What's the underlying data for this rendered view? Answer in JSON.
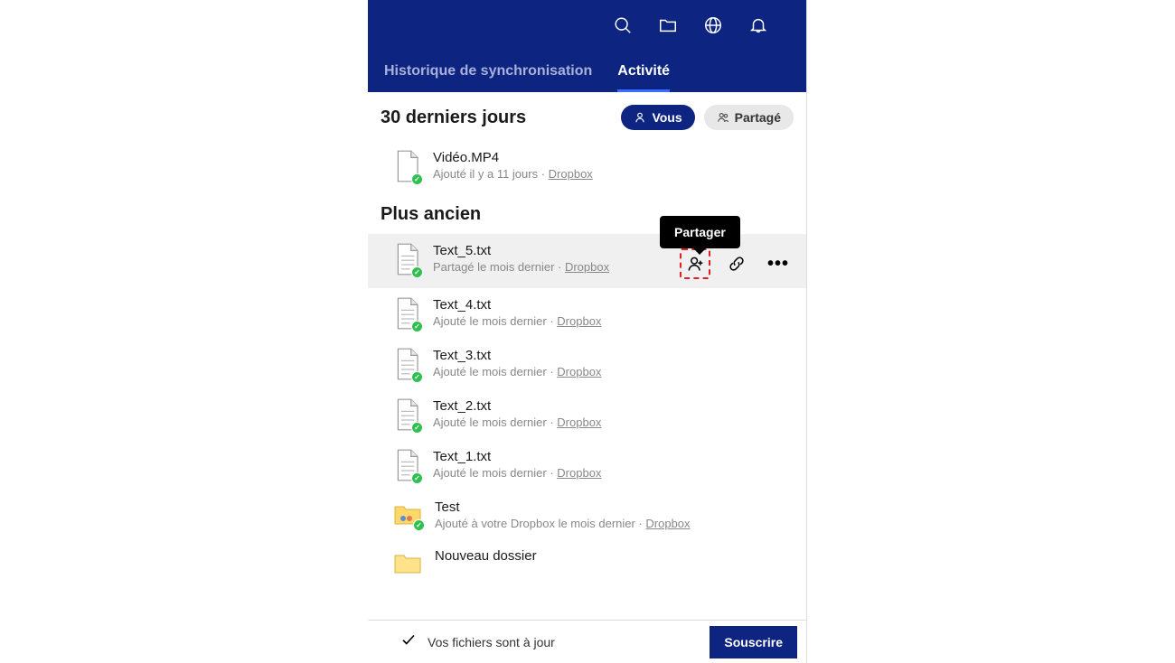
{
  "tabs": {
    "sync": "Historique de synchronisation",
    "activity": "Activité"
  },
  "section_recent": "30 derniers jours",
  "pill_you": "Vous",
  "pill_shared": "Partagé",
  "section_older": "Plus ancien",
  "tooltip_share": "Partager",
  "items": {
    "video": {
      "name": "Vidéo.MP4",
      "meta": "Ajouté il y a 11 jours · ",
      "link": "Dropbox"
    },
    "text5": {
      "name": "Text_5.txt",
      "meta": "Partagé le mois dernier · ",
      "link": "Dropbox"
    },
    "text4": {
      "name": "Text_4.txt",
      "meta": "Ajouté le mois dernier · ",
      "link": "Dropbox"
    },
    "text3": {
      "name": "Text_3.txt",
      "meta": "Ajouté le mois dernier · ",
      "link": "Dropbox"
    },
    "text2": {
      "name": "Text_2.txt",
      "meta": "Ajouté le mois dernier · ",
      "link": "Dropbox"
    },
    "text1": {
      "name": "Text_1.txt",
      "meta": "Ajouté le mois dernier · ",
      "link": "Dropbox"
    },
    "test": {
      "name": "Test",
      "meta": "Ajouté à votre Dropbox le mois dernier · ",
      "link": "Dropbox"
    },
    "nouveau": {
      "name": "Nouveau dossier"
    }
  },
  "footer": {
    "status": "Vos fichiers sont à jour",
    "subscribe": "Souscrire"
  }
}
